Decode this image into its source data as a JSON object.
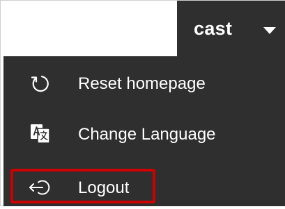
{
  "user_menu": {
    "username": "cast",
    "caret_icon": "caret-down-icon"
  },
  "menu": {
    "items": [
      {
        "label": "Reset homepage",
        "icon": "refresh-icon"
      },
      {
        "label": "Change Language",
        "icon": "translate-icon"
      },
      {
        "label": "Logout",
        "icon": "logout-icon"
      }
    ]
  },
  "colors": {
    "menu_background": "#2f2f2f",
    "text": "#ffffff",
    "highlight": "#cc0000"
  }
}
